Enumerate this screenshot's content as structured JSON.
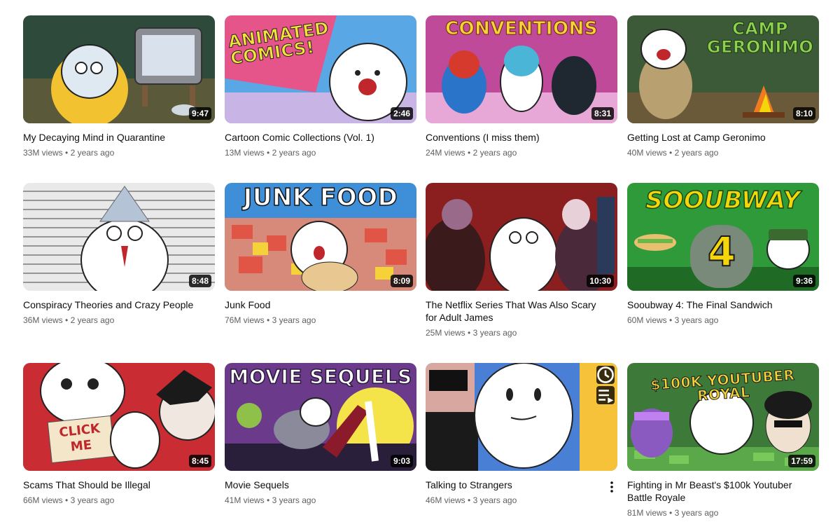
{
  "videos": [
    {
      "title": "My Decaying Mind in Quarantine",
      "views": "33M views",
      "age": "2 years ago",
      "duration": "9:47",
      "thumb_text": "",
      "bg": "#2d4a3a",
      "accent": "#f2c230"
    },
    {
      "title": "Cartoon Comic Collections (Vol. 1)",
      "views": "13M views",
      "age": "2 years ago",
      "duration": "2:46",
      "thumb_text": "ANIMATED COMICS!",
      "bg": "#5aa7e6",
      "accent": "#f5e13b"
    },
    {
      "title": "Conventions (I miss them)",
      "views": "24M views",
      "age": "2 years ago",
      "duration": "8:31",
      "thumb_text": "CONVENTIONS",
      "bg": "#c04a9a",
      "accent": "#f7d23a"
    },
    {
      "title": "Getting Lost at Camp Geronimo",
      "views": "40M views",
      "age": "2 years ago",
      "duration": "8:10",
      "thumb_text": "CAMP GERONIMO",
      "bg": "#3d5a38",
      "accent": "#8fd14f"
    },
    {
      "title": "Conspiracy Theories and Crazy People",
      "views": "36M views",
      "age": "2 years ago",
      "duration": "8:48",
      "thumb_text": "",
      "bg": "#e9e9e9",
      "accent": "#b5c3d6"
    },
    {
      "title": "Junk Food",
      "views": "76M views",
      "age": "3 years ago",
      "duration": "8:09",
      "thumb_text": "JUNK FOOD",
      "bg": "#3f8fd8",
      "accent": "#e05545"
    },
    {
      "title": "The Netflix Series That Was Also Scary for Adult James",
      "views": "25M views",
      "age": "3 years ago",
      "duration": "10:30",
      "thumb_text": "",
      "bg": "#8b1e1e",
      "accent": "#c9c9c9"
    },
    {
      "title": "Sooubway 4: The Final Sandwich",
      "views": "60M views",
      "age": "3 years ago",
      "duration": "9:36",
      "thumb_text": "SOOUBWAY",
      "bg": "#2f9a3a",
      "accent": "#f5d60a"
    },
    {
      "title": "Scams That Should be Illegal",
      "views": "66M views",
      "age": "3 years ago",
      "duration": "8:45",
      "thumb_text": "",
      "bg": "#c0272d",
      "accent": "#f4e6c8"
    },
    {
      "title": "Movie Sequels",
      "views": "41M views",
      "age": "3 years ago",
      "duration": "9:03",
      "thumb_text": "MOVIE SEQUELS",
      "bg": "#6b3a8a",
      "accent": "#f5e34a"
    },
    {
      "title": "Talking to Strangers",
      "views": "46M views",
      "age": "3 years ago",
      "duration": "",
      "thumb_text": "",
      "bg": "#4a7fd6",
      "accent": "#222222"
    },
    {
      "title": "Fighting in Mr Beast's $100k Youtuber Battle Royale",
      "views": "81M views",
      "age": "3 years ago",
      "duration": "17:59",
      "thumb_text": "$100K YOUTUBER ROYAL",
      "bg": "#3d7a3a",
      "accent": "#f5d23a"
    }
  ],
  "icons": {
    "more": "more-vert-icon",
    "watch_later": "clock-icon",
    "add_to_queue": "queue-icon"
  }
}
